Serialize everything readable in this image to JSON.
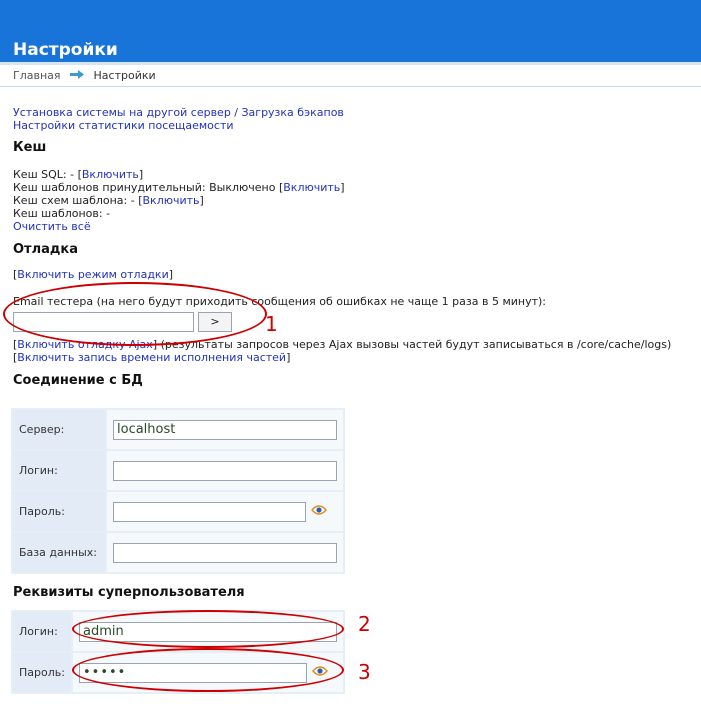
{
  "header": {
    "title": "Настройки"
  },
  "breadcrumb": {
    "home": "Главная",
    "current": "Настройки"
  },
  "links": {
    "install": "Установка системы на другой сервер / Загрузка бэкапов",
    "stats": "Настройки статистики посещаемости"
  },
  "cache": {
    "title": "Кеш",
    "sql_label": "Кеш SQL: - ",
    "sql_enable": "Включить",
    "tpl_forced_label": "Кеш шаблонов принудительный: Выключено ",
    "tpl_forced_enable": "Включить",
    "schema_label": "Кеш схем шаблона: - ",
    "schema_enable": "Включить",
    "tpl_label": "Кеш шаблонов: -",
    "clear_all": "Очистить всё"
  },
  "debug": {
    "title": "Отладка",
    "enable_debug": "Включить режим отладки",
    "email_label": "Email тестера (на него будут приходить сообщения об ошибках не чаще 1 раза в 5 минут):",
    "email_value": "",
    "submit_label": ">",
    "ajax_enable": "Включить отладку Ajax",
    "ajax_desc": " (результаты запросов через Ajax вызовы частей будут записываться в /core/cache/logs)",
    "timing_enable": "Включить запись времени исполнения частей"
  },
  "db": {
    "title": "Соединение с БД",
    "server_label": "Сервер:",
    "server_value": "localhost",
    "login_label": "Логин:",
    "login_value": "",
    "password_label": "Пароль:",
    "password_value": "",
    "database_label": "База данных:",
    "database_value": ""
  },
  "superuser": {
    "title": "Реквизиты суперпользователя",
    "login_label": "Логин:",
    "login_value": "admin",
    "password_label": "Пароль:",
    "password_value": "•••••"
  },
  "annotations": {
    "n1": "1",
    "n2": "2",
    "n3": "3"
  },
  "colors": {
    "header": "#1874d8",
    "link": "#2233bb",
    "annotation": "#cc0000"
  }
}
